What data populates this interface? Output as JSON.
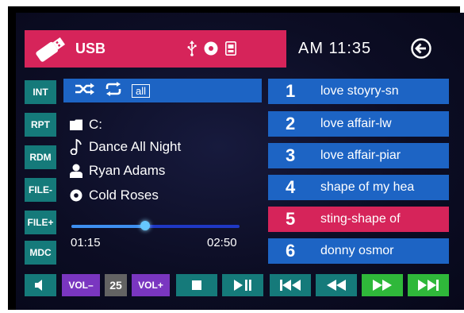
{
  "source": {
    "label": "USB",
    "icon": "usb-drive-icon",
    "status_icons": [
      "usb-symbol-icon",
      "disc-icon",
      "sd-card-icon"
    ]
  },
  "clock": "AM 11:35",
  "side_buttons": [
    "INT",
    "RPT",
    "RDM",
    "FILE-",
    "FILE+",
    "MDC"
  ],
  "mode": {
    "shuffle_icon": "shuffle-icon",
    "repeat_icon": "repeat-icon",
    "repeat_scope": "all"
  },
  "now_playing": {
    "folder": "C:",
    "title": "Dance All Night",
    "artist": "Ryan Adams",
    "album": "Cold Roses"
  },
  "progress": {
    "current": "01:15",
    "total": "02:50",
    "fraction": 0.44
  },
  "playlist": [
    {
      "num": "1",
      "title": "love stoyry-sn"
    },
    {
      "num": "2",
      "title": "love affair-lw"
    },
    {
      "num": "3",
      "title": "love affair-piar"
    },
    {
      "num": "4",
      "title": "shape of my hea"
    },
    {
      "num": "5",
      "title": "sting-shape of",
      "active": true
    },
    {
      "num": "6",
      "title": "donny osmor"
    }
  ],
  "controls": {
    "vol_down": "VOL–",
    "volume": "25",
    "vol_up": "VOL+"
  },
  "colors": {
    "accent_red": "#d6245a",
    "accent_blue": "#1d64c4",
    "teal": "#157a7a",
    "purple": "#7a36c0",
    "green": "#2fb83a"
  }
}
